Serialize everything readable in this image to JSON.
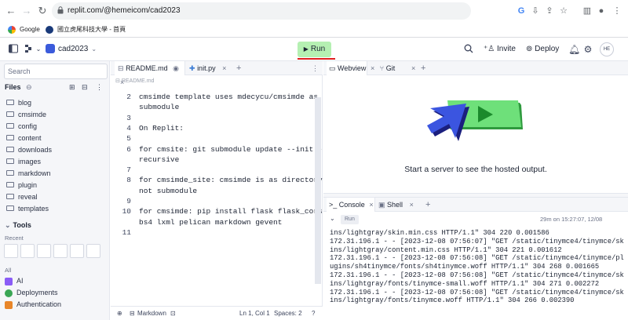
{
  "browser": {
    "url": "replit.com/@hemeicom/cad2023",
    "bookmarks": [
      "Google",
      "國立虎尾科技大學 - 首頁"
    ]
  },
  "header": {
    "repl_name": "cad2023",
    "run_label": "Run",
    "invite_label": "Invite",
    "deploy_label": "Deploy",
    "avatar_initials": "HE"
  },
  "sidebar": {
    "search_placeholder": "Search",
    "files_label": "Files",
    "files": [
      "blog",
      "cmsimde",
      "config",
      "content",
      "downloads",
      "images",
      "markdown",
      "plugin",
      "reveal",
      "templates"
    ],
    "tools_label": "Tools",
    "recent_label": "Recent",
    "all_label": "All",
    "tools": [
      "AI",
      "Deployments",
      "Authentication"
    ]
  },
  "editor": {
    "tabs": [
      "README.md",
      "init.py"
    ],
    "breadcrumb": "README.md",
    "lines": [
      {
        "n": "2",
        "t": "cmsimde template uses mdecycu/cmsimde as"
      },
      {
        "n": "",
        "t": "submodule"
      },
      {
        "n": "3",
        "t": ""
      },
      {
        "n": "4",
        "t": "On Replit:"
      },
      {
        "n": "5",
        "t": ""
      },
      {
        "n": "6",
        "t": "for cmsite: git submodule update --init --"
      },
      {
        "n": "",
        "t": "recursive"
      },
      {
        "n": "7",
        "t": ""
      },
      {
        "n": "8",
        "t": "for cmsimde_site: cmsimde is as directory"
      },
      {
        "n": "",
        "t": "not submodule"
      },
      {
        "n": "9",
        "t": ""
      },
      {
        "n": "10",
        "t": "for cmsimde: pip install flask flask_cors"
      },
      {
        "n": "",
        "t": "bs4 lxml pelican markdown gevent"
      },
      {
        "n": "11",
        "t": ""
      }
    ],
    "status": {
      "language": "Markdown",
      "position": "Ln 1, Col 1",
      "spaces": "Spaces: 2"
    }
  },
  "webview": {
    "tabs": [
      "Webview",
      "Git"
    ],
    "message": "Start a server to see the hosted output."
  },
  "console": {
    "tabs": [
      "Console",
      "Shell"
    ],
    "run_pill": "Run",
    "run_time": "29m on 15:27:07, 12/08",
    "logs": [
      "ins/lightgray/skin.min.css HTTP/1.1\" 304 220 0.001586",
      "172.31.196.1 - - [2023-12-08 07:56:07] \"GET /static/tinymce4/tinymce/sk",
      "ins/lightgray/content.min.css HTTP/1.1\" 304 221 0.001612",
      "172.31.196.1 - - [2023-12-08 07:56:08] \"GET /static/tinymce4/tinymce/pl",
      "ugins/sh4tinymce/fonts/sh4tinymce.woff HTTP/1.1\" 304 268 0.001665",
      "172.31.196.1 - - [2023-12-08 07:56:08] \"GET /static/tinymce4/tinymce/sk",
      "ins/lightgray/fonts/tinymce-small.woff HTTP/1.1\" 304 271 0.002272",
      "172.31.196.1 - - [2023-12-08 07:56:08] \"GET /static/tinymce4/tinymce/sk",
      "ins/lightgray/fonts/tinymce.woff HTTP/1.1\" 304 266 0.002390"
    ]
  }
}
